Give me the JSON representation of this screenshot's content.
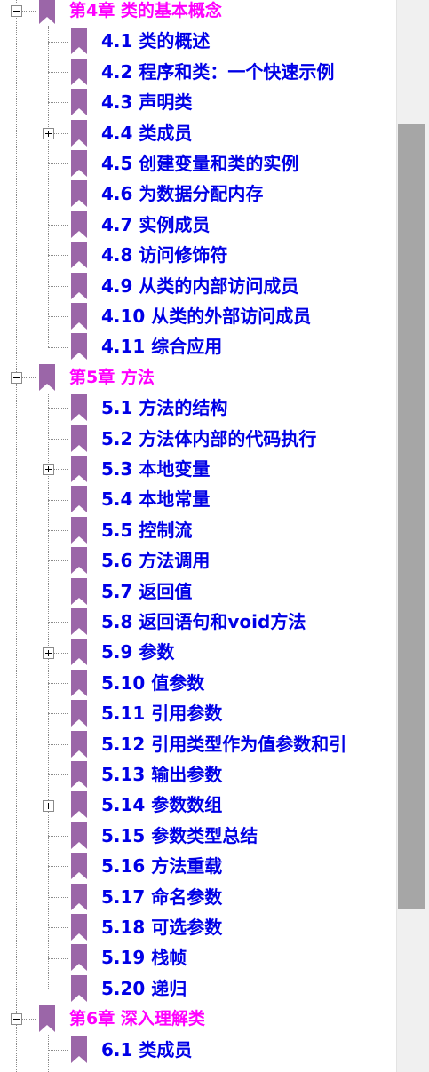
{
  "tree": {
    "rows": [
      {
        "level": 0,
        "label": "第4章  类的基本概念",
        "toggle": "minus",
        "last": false
      },
      {
        "level": 1,
        "label": "4.1  类的概述",
        "toggle": null,
        "last": false
      },
      {
        "level": 1,
        "label": "4.2  程序和类：一个快速示例",
        "toggle": null,
        "last": false
      },
      {
        "level": 1,
        "label": "4.3  声明类",
        "toggle": null,
        "last": false
      },
      {
        "level": 1,
        "label": "4.4  类成员",
        "toggle": "plus",
        "last": false
      },
      {
        "level": 1,
        "label": "4.5  创建变量和类的实例",
        "toggle": null,
        "last": false
      },
      {
        "level": 1,
        "label": "4.6  为数据分配内存",
        "toggle": null,
        "last": false
      },
      {
        "level": 1,
        "label": "4.7  实例成员",
        "toggle": null,
        "last": false
      },
      {
        "level": 1,
        "label": "4.8  访问修饰符",
        "toggle": null,
        "last": false
      },
      {
        "level": 1,
        "label": "4.9  从类的内部访问成员",
        "toggle": null,
        "last": false
      },
      {
        "level": 1,
        "label": "4.10  从类的外部访问成员",
        "toggle": null,
        "last": false
      },
      {
        "level": 1,
        "label": "4.11  综合应用",
        "toggle": null,
        "last": true
      },
      {
        "level": 0,
        "label": "第5章  方法",
        "toggle": "minus",
        "last": false
      },
      {
        "level": 1,
        "label": "5.1  方法的结构",
        "toggle": null,
        "last": false
      },
      {
        "level": 1,
        "label": "5.2  方法体内部的代码执行",
        "toggle": null,
        "last": false
      },
      {
        "level": 1,
        "label": "5.3  本地变量",
        "toggle": "plus",
        "last": false
      },
      {
        "level": 1,
        "label": "5.4  本地常量",
        "toggle": null,
        "last": false
      },
      {
        "level": 1,
        "label": "5.5  控制流",
        "toggle": null,
        "last": false
      },
      {
        "level": 1,
        "label": "5.6  方法调用",
        "toggle": null,
        "last": false
      },
      {
        "level": 1,
        "label": "5.7  返回值",
        "toggle": null,
        "last": false
      },
      {
        "level": 1,
        "label": "5.8  返回语句和void方法",
        "toggle": null,
        "last": false
      },
      {
        "level": 1,
        "label": "5.9  参数",
        "toggle": "plus",
        "last": false
      },
      {
        "level": 1,
        "label": "5.10  值参数",
        "toggle": null,
        "last": false
      },
      {
        "level": 1,
        "label": "5.11  引用参数",
        "toggle": null,
        "last": false
      },
      {
        "level": 1,
        "label": "5.12  引用类型作为值参数和引",
        "toggle": null,
        "last": false
      },
      {
        "level": 1,
        "label": "5.13  输出参数",
        "toggle": null,
        "last": false
      },
      {
        "level": 1,
        "label": "5.14  参数数组",
        "toggle": "plus",
        "last": false
      },
      {
        "level": 1,
        "label": "5.15  参数类型总结",
        "toggle": null,
        "last": false
      },
      {
        "level": 1,
        "label": "5.16  方法重载",
        "toggle": null,
        "last": false
      },
      {
        "level": 1,
        "label": "5.17  命名参数",
        "toggle": null,
        "last": false
      },
      {
        "level": 1,
        "label": "5.18  可选参数",
        "toggle": null,
        "last": false
      },
      {
        "level": 1,
        "label": "5.19  栈帧",
        "toggle": null,
        "last": false
      },
      {
        "level": 1,
        "label": "5.20  递归",
        "toggle": null,
        "last": true
      },
      {
        "level": 0,
        "label": "第6章  深入理解类",
        "toggle": "minus",
        "last": false
      },
      {
        "level": 1,
        "label": "6.1  类成员",
        "toggle": null,
        "last": false
      }
    ]
  },
  "colors": {
    "chapter_text": "#ff00ff",
    "section_text": "#0000e6",
    "bookmark_icon": "#9b66a8",
    "scrollbar_thumb": "#a6a6a6"
  },
  "icons": {
    "bookmark": "bookmark-icon",
    "expand": "expand-plus-icon",
    "collapse": "collapse-minus-icon"
  }
}
